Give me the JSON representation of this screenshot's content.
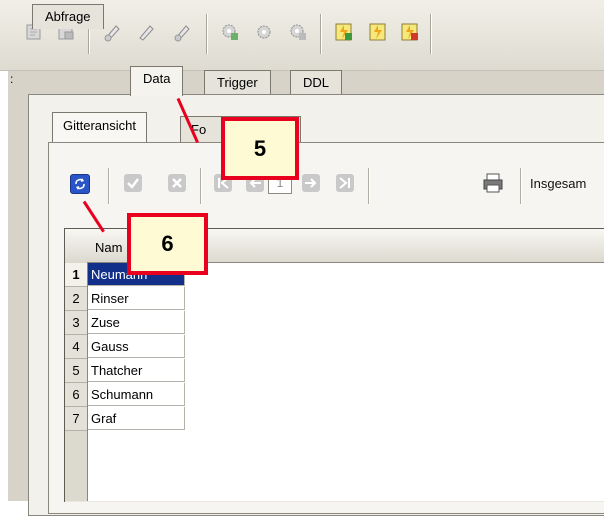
{
  "top_tabs": [
    {
      "label": "Abfrage",
      "active": false
    },
    {
      "label": "Data",
      "active": true
    },
    {
      "label": "Trigger",
      "active": false
    },
    {
      "label": "DDL",
      "active": false
    }
  ],
  "view_tabs": [
    {
      "label": "Gitteransicht",
      "active": true
    },
    {
      "label": "Fo",
      "active": false
    },
    {
      "label": "cht",
      "active": false
    }
  ],
  "navigation": {
    "page": "1",
    "total_label": "Insgesam"
  },
  "grid": {
    "column_header": "Nam",
    "rows": [
      {
        "num": "1",
        "name": "Neumann",
        "selected": true
      },
      {
        "num": "2",
        "name": "Rinser",
        "selected": false
      },
      {
        "num": "3",
        "name": "Zuse",
        "selected": false
      },
      {
        "num": "4",
        "name": "Gauss",
        "selected": false
      },
      {
        "num": "5",
        "name": "Thatcher",
        "selected": false
      },
      {
        "num": "6",
        "name": "Schumann",
        "selected": false
      },
      {
        "num": "7",
        "name": "Graf",
        "selected": false
      }
    ]
  },
  "callouts": {
    "five": "5",
    "six": "6"
  },
  "left_mark": ":",
  "colors": {
    "callout_border": "#e8001e",
    "callout_fill": "#fefad4",
    "selection": "#12308a"
  }
}
